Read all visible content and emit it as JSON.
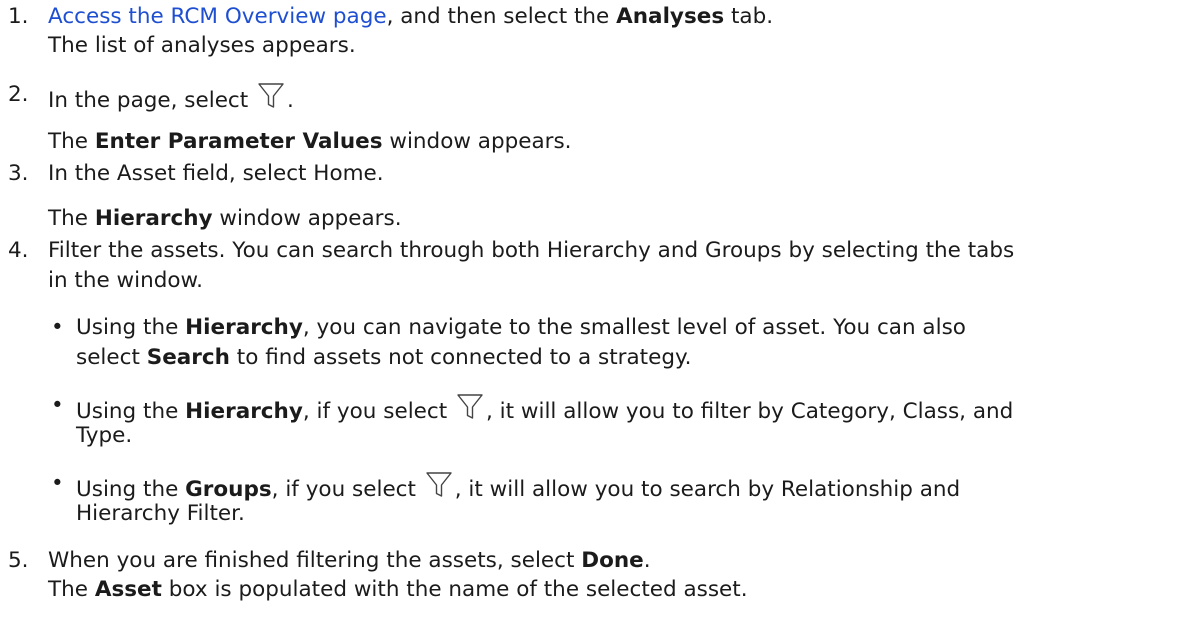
{
  "icons": {
    "filter": "filter-funnel-icon"
  },
  "steps": [
    {
      "number": "1.",
      "link": "Access the RCM Overview page",
      "text_a": ", and then select the ",
      "bold_a": "Analyses",
      "text_b": " tab.",
      "result": "The list of analyses appears."
    },
    {
      "number": "2.",
      "text_a": "In the page, select ",
      "text_b": ".",
      "result_bold": "Enter Parameter Values",
      "result_text": " window appears.",
      "result_prefix": "The "
    },
    {
      "number": "3.",
      "text": "In the Asset field, select Home.",
      "result_prefix": "The ",
      "result_bold": "Hierarchy",
      "result_text": " window appears."
    },
    {
      "number": "4.",
      "text_line1": "Filter the assets. You can search through both Hierarchy and Groups by selecting the tabs",
      "text_line2": "in the window.",
      "bullets": [
        {
          "a": "Using the ",
          "b": "Hierarchy",
          "c": ", you can navigate to the smallest level of asset. You can also",
          "d": "select ",
          "e": "Search",
          "f": " to find assets not connected to a strategy."
        },
        {
          "a": "Using the ",
          "b": "Hierarchy",
          "c": ", if you select ",
          "d": ", it will allow you to filter by Category, Class, and",
          "e": "Type."
        },
        {
          "a": "Using the ",
          "b": "Groups",
          "c": ", if you select ",
          "d": ", it will allow you to search by Relationship and",
          "e": "Hierarchy Filter."
        }
      ]
    },
    {
      "number": "5.",
      "text_a": "When you are finished filtering the assets, select ",
      "bold_a": "Done",
      "text_b": ".",
      "result_prefix": "The ",
      "result_bold": "Asset",
      "result_text": " box is populated with the name of the selected asset."
    }
  ]
}
